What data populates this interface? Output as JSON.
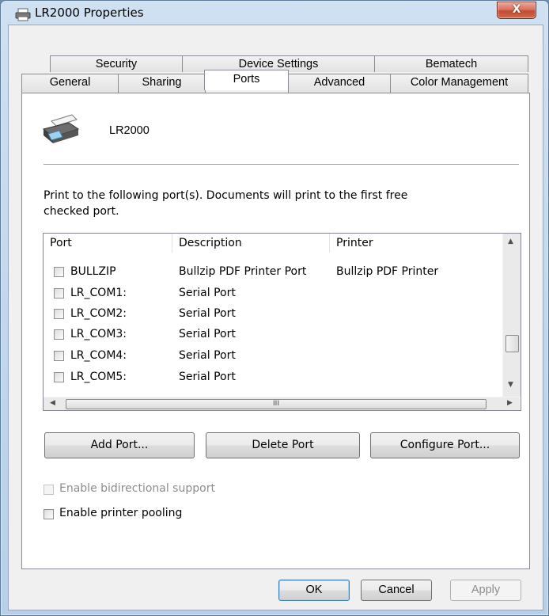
{
  "window": {
    "title": "LR2000 Properties",
    "close_glyph": "X"
  },
  "tabs_row_top": [
    "Security",
    "Device Settings",
    "Bematech"
  ],
  "tabs_row_bottom": [
    "General",
    "Sharing",
    "Ports",
    "Advanced",
    "Color Management"
  ],
  "active_tab": "Ports",
  "printer": {
    "name": "LR2000",
    "icon": "printer-icon"
  },
  "instruction": "Print to the following port(s). Documents will print to the first free checked port.",
  "port_list": {
    "columns": [
      "Port",
      "Description",
      "Printer"
    ],
    "rows": [
      {
        "port": "BULLZIP",
        "description": "Bullzip PDF Printer Port",
        "printer": "Bullzip PDF Printer",
        "checked": false
      },
      {
        "port": "LR_COM1:",
        "description": "Serial Port",
        "printer": "",
        "checked": false
      },
      {
        "port": "LR_COM2:",
        "description": "Serial Port",
        "printer": "",
        "checked": false
      },
      {
        "port": "LR_COM3:",
        "description": "Serial Port",
        "printer": "",
        "checked": false
      },
      {
        "port": "LR_COM4:",
        "description": "Serial Port",
        "printer": "",
        "checked": false
      },
      {
        "port": "LR_COM5:",
        "description": "Serial Port",
        "printer": "",
        "checked": false
      }
    ],
    "hscroll_thumb_glyph": "III"
  },
  "buttons": {
    "add_port": "Add Port...",
    "delete_port": "Delete Port",
    "configure_port": "Configure Port..."
  },
  "options": {
    "bidirectional": {
      "label": "Enable bidirectional support",
      "checked": false,
      "enabled": false
    },
    "pooling": {
      "label": "Enable printer pooling",
      "checked": false,
      "enabled": true
    }
  },
  "dialog_buttons": {
    "ok": "OK",
    "cancel": "Cancel",
    "apply": "Apply"
  },
  "colors": {
    "accent": "#3c7fb1",
    "close_red": "#c44a33",
    "frame": "#c2d7ee"
  }
}
